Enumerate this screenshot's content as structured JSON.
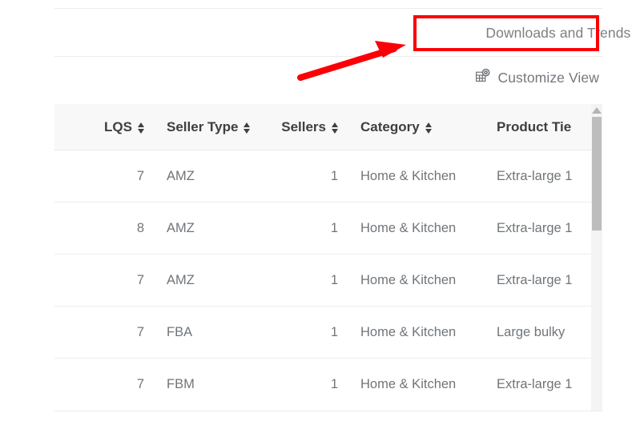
{
  "toolbar": {
    "view_selector_label": "Downloads and Trends",
    "view_selector_caret": "▾",
    "customize_view_label": "Customize View",
    "customize_view_icon": "table-gear-icon"
  },
  "annotation": {
    "color": "#fb0007",
    "box_target": "view-selector",
    "arrow_from": "375,97",
    "arrow_to": "503,57"
  },
  "table": {
    "sort_icon": "sort-arrows-icon",
    "columns": [
      {
        "key": "lqs",
        "label": "LQS",
        "sortable": true,
        "align": "right"
      },
      {
        "key": "seller_type",
        "label": "Seller Type",
        "sortable": true,
        "align": "left"
      },
      {
        "key": "sellers",
        "label": "Sellers",
        "sortable": true,
        "align": "right"
      },
      {
        "key": "category",
        "label": "Category",
        "sortable": true,
        "align": "left"
      },
      {
        "key": "tier",
        "label": "Product Tie",
        "sortable": false,
        "align": "left"
      }
    ],
    "rows": [
      {
        "lqs": "7",
        "seller_type": "AMZ",
        "sellers": "1",
        "category": "Home & Kitchen",
        "tier": "Extra-large 1"
      },
      {
        "lqs": "8",
        "seller_type": "AMZ",
        "sellers": "1",
        "category": "Home & Kitchen",
        "tier": "Extra-large 1"
      },
      {
        "lqs": "7",
        "seller_type": "AMZ",
        "sellers": "1",
        "category": "Home & Kitchen",
        "tier": "Extra-large 1"
      },
      {
        "lqs": "7",
        "seller_type": "FBA",
        "sellers": "1",
        "category": "Home & Kitchen",
        "tier": "Large bulky"
      },
      {
        "lqs": "7",
        "seller_type": "FBM",
        "sellers": "1",
        "category": "Home & Kitchen",
        "tier": "Extra-large 1"
      }
    ]
  },
  "scrollbar": {
    "orientation": "vertical",
    "up_arrow_icon": "triangle-up-icon"
  }
}
